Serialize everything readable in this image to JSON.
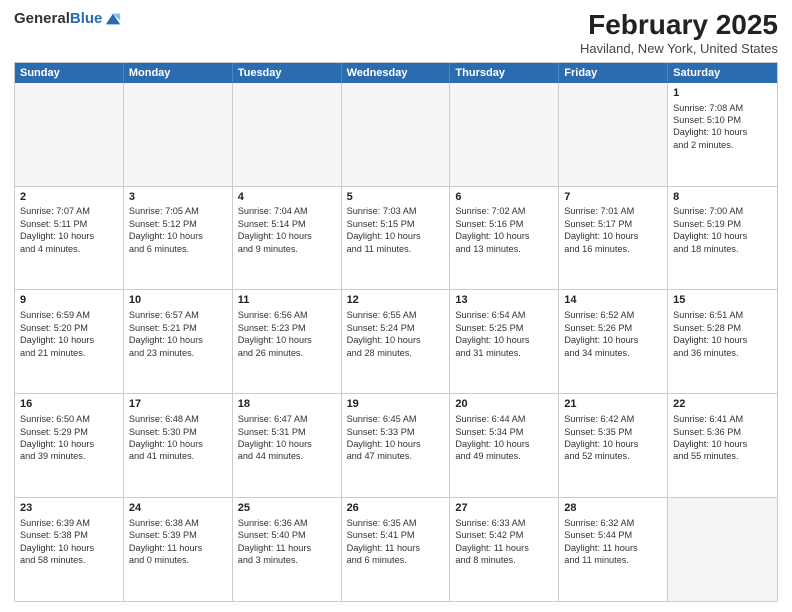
{
  "header": {
    "logo_general": "General",
    "logo_blue": "Blue",
    "title": "February 2025",
    "location": "Haviland, New York, United States"
  },
  "days_of_week": [
    "Sunday",
    "Monday",
    "Tuesday",
    "Wednesday",
    "Thursday",
    "Friday",
    "Saturday"
  ],
  "rows": [
    [
      {
        "day": "",
        "empty": true
      },
      {
        "day": "",
        "empty": true
      },
      {
        "day": "",
        "empty": true
      },
      {
        "day": "",
        "empty": true
      },
      {
        "day": "",
        "empty": true
      },
      {
        "day": "",
        "empty": true
      },
      {
        "day": "1",
        "lines": [
          "Sunrise: 7:08 AM",
          "Sunset: 5:10 PM",
          "Daylight: 10 hours",
          "and 2 minutes."
        ]
      }
    ],
    [
      {
        "day": "2",
        "lines": [
          "Sunrise: 7:07 AM",
          "Sunset: 5:11 PM",
          "Daylight: 10 hours",
          "and 4 minutes."
        ]
      },
      {
        "day": "3",
        "lines": [
          "Sunrise: 7:05 AM",
          "Sunset: 5:12 PM",
          "Daylight: 10 hours",
          "and 6 minutes."
        ]
      },
      {
        "day": "4",
        "lines": [
          "Sunrise: 7:04 AM",
          "Sunset: 5:14 PM",
          "Daylight: 10 hours",
          "and 9 minutes."
        ]
      },
      {
        "day": "5",
        "lines": [
          "Sunrise: 7:03 AM",
          "Sunset: 5:15 PM",
          "Daylight: 10 hours",
          "and 11 minutes."
        ]
      },
      {
        "day": "6",
        "lines": [
          "Sunrise: 7:02 AM",
          "Sunset: 5:16 PM",
          "Daylight: 10 hours",
          "and 13 minutes."
        ]
      },
      {
        "day": "7",
        "lines": [
          "Sunrise: 7:01 AM",
          "Sunset: 5:17 PM",
          "Daylight: 10 hours",
          "and 16 minutes."
        ]
      },
      {
        "day": "8",
        "lines": [
          "Sunrise: 7:00 AM",
          "Sunset: 5:19 PM",
          "Daylight: 10 hours",
          "and 18 minutes."
        ]
      }
    ],
    [
      {
        "day": "9",
        "lines": [
          "Sunrise: 6:59 AM",
          "Sunset: 5:20 PM",
          "Daylight: 10 hours",
          "and 21 minutes."
        ]
      },
      {
        "day": "10",
        "lines": [
          "Sunrise: 6:57 AM",
          "Sunset: 5:21 PM",
          "Daylight: 10 hours",
          "and 23 minutes."
        ]
      },
      {
        "day": "11",
        "lines": [
          "Sunrise: 6:56 AM",
          "Sunset: 5:23 PM",
          "Daylight: 10 hours",
          "and 26 minutes."
        ]
      },
      {
        "day": "12",
        "lines": [
          "Sunrise: 6:55 AM",
          "Sunset: 5:24 PM",
          "Daylight: 10 hours",
          "and 28 minutes."
        ]
      },
      {
        "day": "13",
        "lines": [
          "Sunrise: 6:54 AM",
          "Sunset: 5:25 PM",
          "Daylight: 10 hours",
          "and 31 minutes."
        ]
      },
      {
        "day": "14",
        "lines": [
          "Sunrise: 6:52 AM",
          "Sunset: 5:26 PM",
          "Daylight: 10 hours",
          "and 34 minutes."
        ]
      },
      {
        "day": "15",
        "lines": [
          "Sunrise: 6:51 AM",
          "Sunset: 5:28 PM",
          "Daylight: 10 hours",
          "and 36 minutes."
        ]
      }
    ],
    [
      {
        "day": "16",
        "lines": [
          "Sunrise: 6:50 AM",
          "Sunset: 5:29 PM",
          "Daylight: 10 hours",
          "and 39 minutes."
        ]
      },
      {
        "day": "17",
        "lines": [
          "Sunrise: 6:48 AM",
          "Sunset: 5:30 PM",
          "Daylight: 10 hours",
          "and 41 minutes."
        ]
      },
      {
        "day": "18",
        "lines": [
          "Sunrise: 6:47 AM",
          "Sunset: 5:31 PM",
          "Daylight: 10 hours",
          "and 44 minutes."
        ]
      },
      {
        "day": "19",
        "lines": [
          "Sunrise: 6:45 AM",
          "Sunset: 5:33 PM",
          "Daylight: 10 hours",
          "and 47 minutes."
        ]
      },
      {
        "day": "20",
        "lines": [
          "Sunrise: 6:44 AM",
          "Sunset: 5:34 PM",
          "Daylight: 10 hours",
          "and 49 minutes."
        ]
      },
      {
        "day": "21",
        "lines": [
          "Sunrise: 6:42 AM",
          "Sunset: 5:35 PM",
          "Daylight: 10 hours",
          "and 52 minutes."
        ]
      },
      {
        "day": "22",
        "lines": [
          "Sunrise: 6:41 AM",
          "Sunset: 5:36 PM",
          "Daylight: 10 hours",
          "and 55 minutes."
        ]
      }
    ],
    [
      {
        "day": "23",
        "lines": [
          "Sunrise: 6:39 AM",
          "Sunset: 5:38 PM",
          "Daylight: 10 hours",
          "and 58 minutes."
        ]
      },
      {
        "day": "24",
        "lines": [
          "Sunrise: 6:38 AM",
          "Sunset: 5:39 PM",
          "Daylight: 11 hours",
          "and 0 minutes."
        ]
      },
      {
        "day": "25",
        "lines": [
          "Sunrise: 6:36 AM",
          "Sunset: 5:40 PM",
          "Daylight: 11 hours",
          "and 3 minutes."
        ]
      },
      {
        "day": "26",
        "lines": [
          "Sunrise: 6:35 AM",
          "Sunset: 5:41 PM",
          "Daylight: 11 hours",
          "and 6 minutes."
        ]
      },
      {
        "day": "27",
        "lines": [
          "Sunrise: 6:33 AM",
          "Sunset: 5:42 PM",
          "Daylight: 11 hours",
          "and 8 minutes."
        ]
      },
      {
        "day": "28",
        "lines": [
          "Sunrise: 6:32 AM",
          "Sunset: 5:44 PM",
          "Daylight: 11 hours",
          "and 11 minutes."
        ]
      },
      {
        "day": "",
        "empty": true
      }
    ]
  ]
}
